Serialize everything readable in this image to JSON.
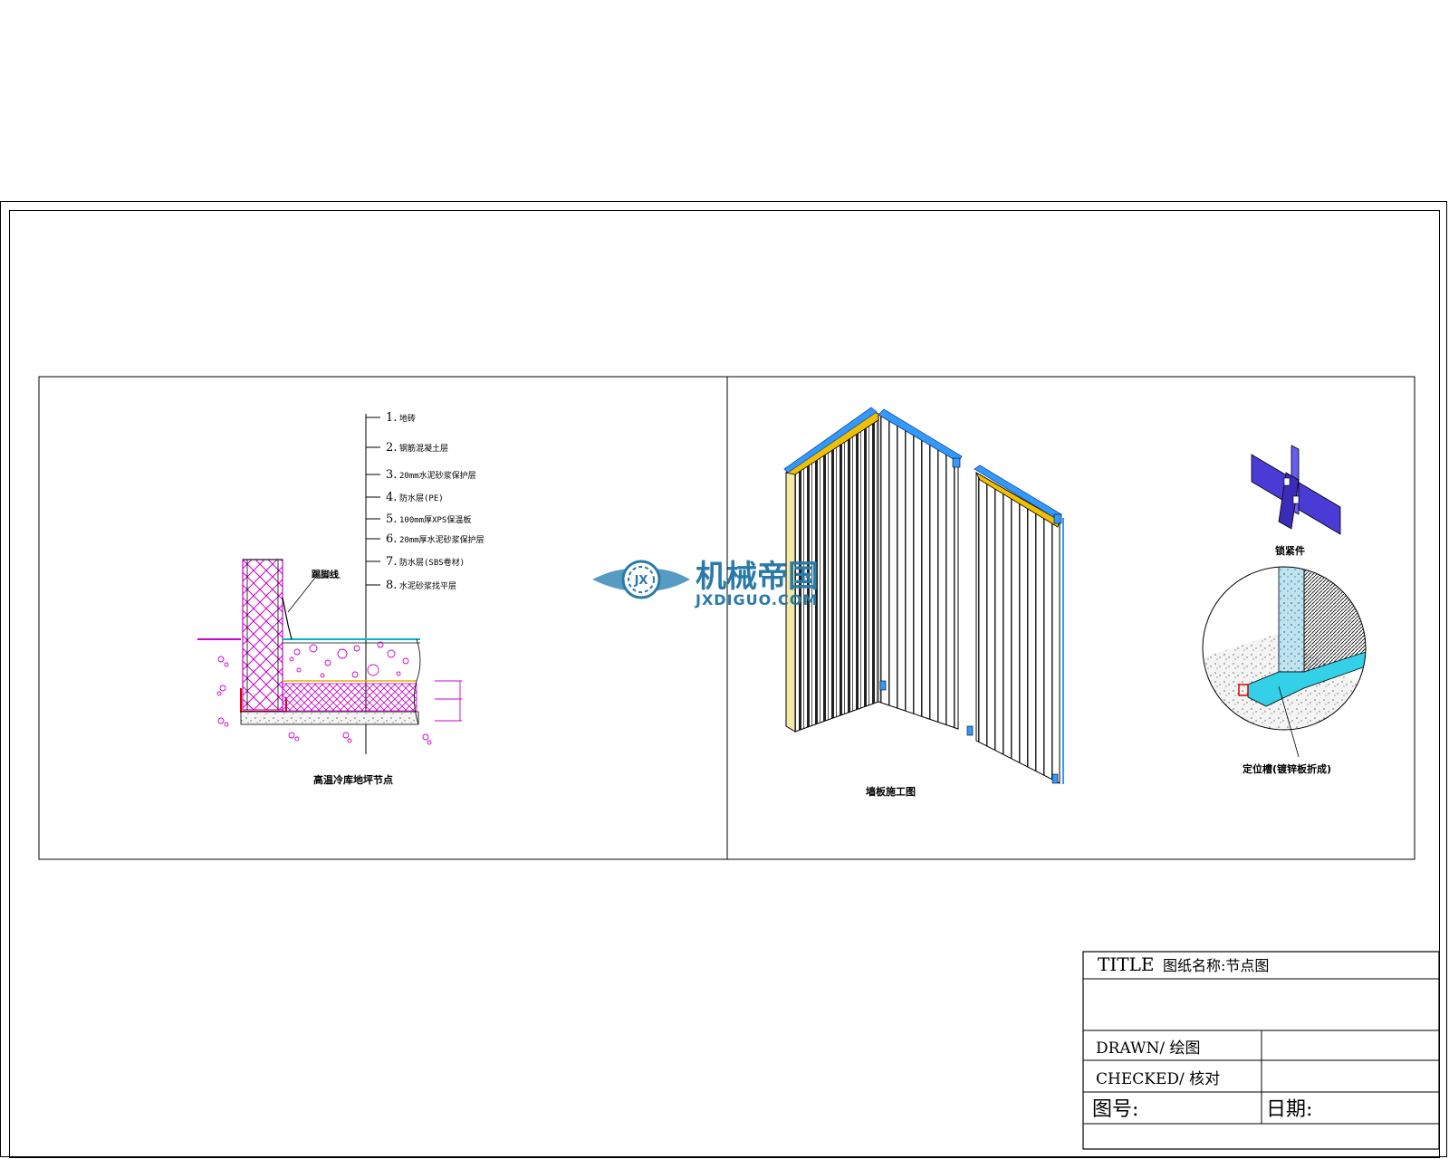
{
  "left_detail": {
    "layers": [
      {
        "num": "1.",
        "text": "地砖"
      },
      {
        "num": "2.",
        "text": "钢筋混凝土层"
      },
      {
        "num": "3.",
        "text": "20mm水泥砂浆保护层"
      },
      {
        "num": "4.",
        "text": "防水层(PE)"
      },
      {
        "num": "5.",
        "text": "100mm厚XPS保温板"
      },
      {
        "num": "6.",
        "text": "20mm厚水泥砂浆保护层"
      },
      {
        "num": "7.",
        "text": "防水层(SBS卷材)"
      },
      {
        "num": "8.",
        "text": "水泥砂浆找平层"
      }
    ],
    "callout": "踢脚线",
    "caption": "高温冷库地坪节点"
  },
  "right_detail": {
    "panel_caption": "墙板施工图",
    "fastener_caption": "锁紧件",
    "detail_caption": "定位槽(镀锌板折成)"
  },
  "watermark": {
    "cn": "机械帝国",
    "en": "JXDIGUO.COM",
    "badge": "JX"
  },
  "title_block": {
    "title_label": "TITLE",
    "title_value": "图纸名称:节点图",
    "drawn": "DRAWN/ 绘图",
    "checked": "CHECKED/ 核对",
    "drawing_no": "图号:",
    "date": "日期:"
  },
  "colors": {
    "insulation": "#cc00cc",
    "panel_yellow": "#f0c000",
    "panel_blue": "#3399ff",
    "fastener": "#4b3bd6",
    "channel_cyan": "#33d0e8",
    "watermark": "#2a7aa8"
  }
}
